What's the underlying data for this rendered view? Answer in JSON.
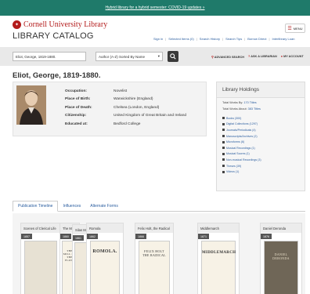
{
  "banner": {
    "text": "Hybrid library for a hybrid semester: COVID-19 updates »"
  },
  "header": {
    "university": "Cornell University Library",
    "catalog_title": "LIBRARY CATALOG",
    "menu_label": "MENU",
    "links": [
      "Sign in",
      "Selected Items (0)",
      "Search History",
      "Search Tips",
      "Borrow Direct",
      "Interlibrary Loan"
    ]
  },
  "search": {
    "value": "Eliot, George, 1819-1880.",
    "sort": "Author (A-Z) Sorted By Name",
    "advanced": "ADVANCED SEARCH",
    "ask": "ASK A LIBRARIAN",
    "account": "MY ACCOUNT"
  },
  "record": {
    "title": "Eliot, George, 1819-1880.",
    "fields": [
      {
        "label": "Occupation:",
        "value": "Novelist"
      },
      {
        "label": "Place of Birth:",
        "value": "Warwickshire (England)"
      },
      {
        "label": "Place of Death:",
        "value": "Chelsea (London, England)"
      },
      {
        "label": "Citizenship:",
        "value": "United Kingdom of Great Britain and Ireland"
      },
      {
        "label": "Educated at:",
        "value": "Bedford College"
      }
    ]
  },
  "holdings": {
    "heading": "Library Holdings",
    "works_by_prefix": "Total Works By:",
    "works_by_link": "170 Titles",
    "works_about_prefix": "Total Works About:",
    "works_about_link": "383 Titles",
    "items": [
      "Books (300)",
      "Digital Collections (1297)",
      "Journals/Periodicals (4)",
      "Manuscripts/Archives (2)",
      "Microforms (6)",
      "Musical Recordings (1)",
      "Musical Scores (1)",
      "Non-musical Recordings (3)",
      "Theses (39)",
      "Videos (1)"
    ]
  },
  "tabs": [
    "Publication Timeline",
    "Influences",
    "Alternate Forms"
  ],
  "timeline": {
    "books": [
      {
        "title": "Scenes of Clerical Life",
        "year": "1857"
      },
      {
        "title": "The Mill on the Floss",
        "year": "1860"
      },
      {
        "title": "Silas Marner",
        "year": "1861"
      },
      {
        "title": "Romola",
        "year": "1862"
      },
      {
        "title": "Felix Holt, the Radical",
        "year": "1866"
      },
      {
        "title": "Middlemarch",
        "year": "1871"
      },
      {
        "title": "Daniel Deronda",
        "year": "1876"
      }
    ],
    "covers": {
      "mill": "THE MILL ON THE FLOSS",
      "romola": "ROMOLA.",
      "felix": "FELIX HOLT THE RADICAL",
      "middlemarch": "MIDDLEMARCH",
      "deronda": "DANIEL DERONDA"
    }
  }
}
